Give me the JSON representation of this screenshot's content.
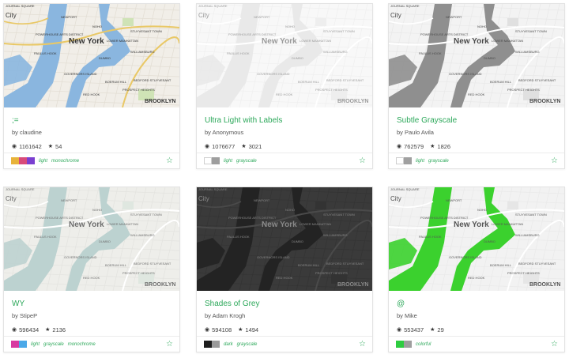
{
  "map_label": "New York",
  "map_labels": {
    "city": "City",
    "borough": "BROOKLYN",
    "greenpoint": "GREENPOINT",
    "williamsburg": "WILLIAMSBURG",
    "stuyvesant": "STUYVESANT TOWN",
    "lower_manhattan": "LOWER MANHATTAN",
    "dumbo": "DUMBO",
    "red_hook": "RED HOOK",
    "gowanus": "GOWANUS",
    "fort_greene": "FORT GREENE",
    "boerum_hill": "BOERUM HILL",
    "bedford": "BEDFORD STUYVESANT",
    "prospect": "PROSPECT HEIGHTS",
    "governors": "GOVERNORS ISLAND",
    "liberty": "Liberty State Park",
    "barclays": "Barclays Center",
    "park_slope": "PARK SLOPE",
    "crown": "CROWN HEIGHTS",
    "newport": "NEWPORT",
    "noho": "NOHO",
    "tribeca": "TRIBECA",
    "powerhouse": "POWERHOUSE ARTS DISTRICT",
    "paulus": "PAULUS HOOK",
    "journal": "JOURNAL SQUARE"
  },
  "stat_icons": {
    "views": "eye-icon",
    "stars": "star-icon"
  },
  "cards": [
    {
      "title": ";=",
      "author": "by claudine",
      "views": "1161642",
      "stars": "54",
      "tags": [
        "light",
        "monochrome"
      ],
      "swatches": [
        "#e8b33a",
        "#d84a7a",
        "#7a3fd0"
      ],
      "theme": "color"
    },
    {
      "title": "Ultra Light with Labels",
      "author": "by Anonymous",
      "views": "1076677",
      "stars": "3021",
      "tags": [
        "light",
        "grayscale"
      ],
      "swatches": [
        "#ffffff",
        "#9e9e9e"
      ],
      "theme": "ultralight"
    },
    {
      "title": "Subtle Grayscale",
      "author": "by Paulo Avila",
      "views": "762579",
      "stars": "1826",
      "tags": [
        "light",
        "grayscale"
      ],
      "swatches": [
        "#ffffff",
        "#a0a0a0"
      ],
      "theme": "subtle"
    },
    {
      "title": "WY",
      "author": "by StipeP",
      "views": "596434",
      "stars": "2136",
      "tags": [
        "light",
        "grayscale",
        "monochrome"
      ],
      "swatches": [
        "#d83aa0",
        "#4aa8e8"
      ],
      "theme": "wy"
    },
    {
      "title": "Shades of Grey",
      "author": "by Adam Krogh",
      "views": "594108",
      "stars": "1494",
      "tags": [
        "dark",
        "grayscale"
      ],
      "swatches": [
        "#1e1e1e",
        "#9a9a9a"
      ],
      "theme": "dark"
    },
    {
      "title": "@",
      "author": "by Mike",
      "views": "553437",
      "stars": "29",
      "tags": [
        "colorful"
      ],
      "swatches": [
        "#2ecc40",
        "#9e9e9e"
      ],
      "theme": "green"
    }
  ]
}
